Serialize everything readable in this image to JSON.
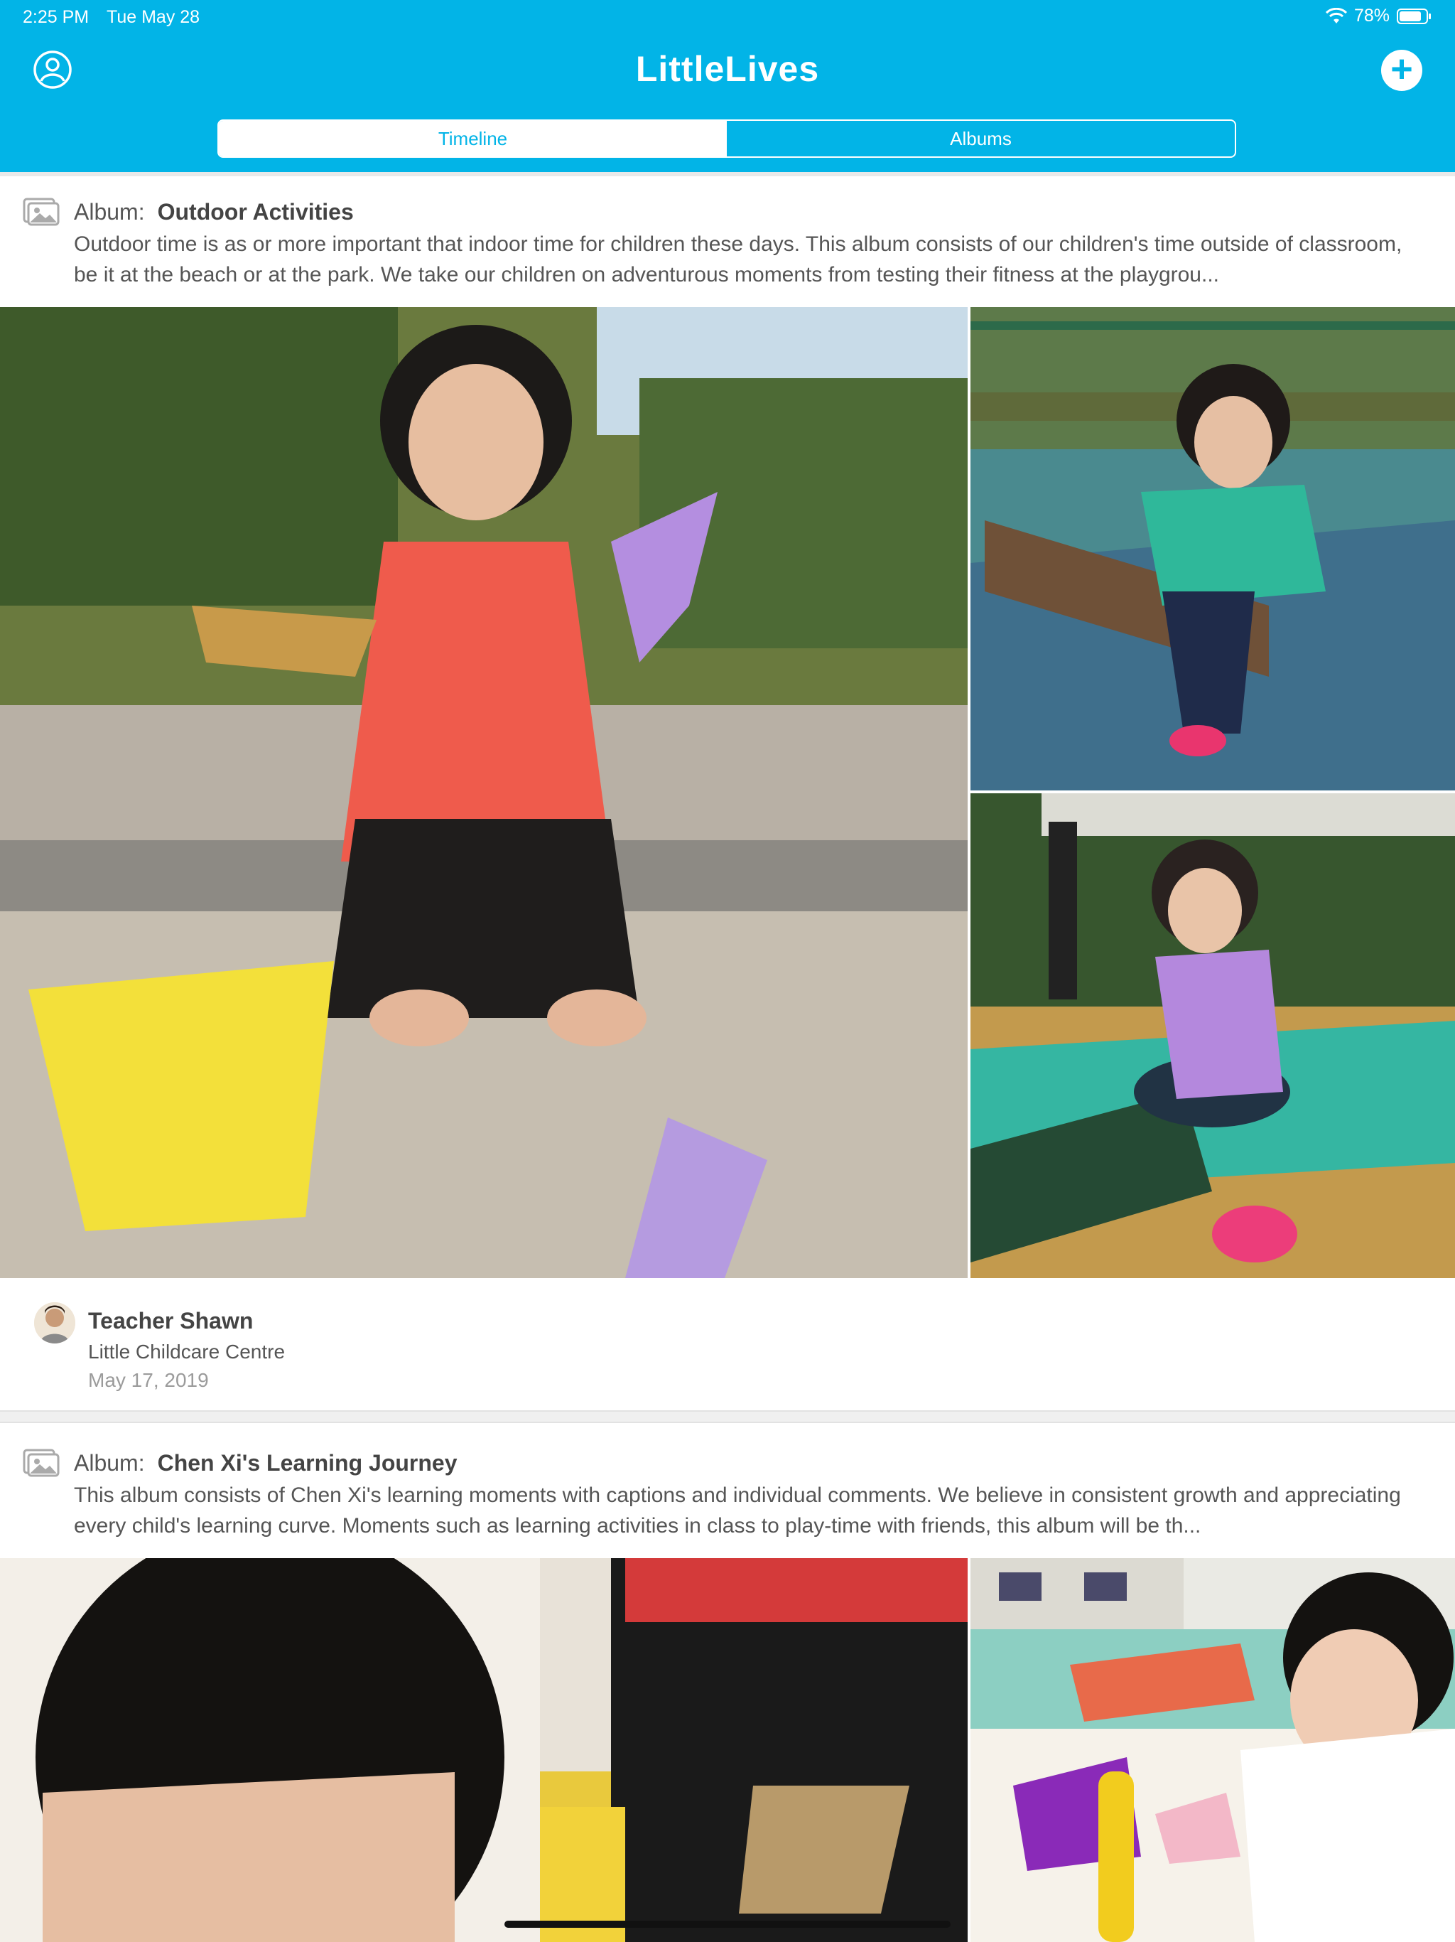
{
  "status_bar": {
    "time": "2:25 PM",
    "date": "Tue May 28",
    "battery": "78%"
  },
  "header": {
    "title": "LittleLives",
    "profile_icon": "profile-icon",
    "add_icon": "plus-icon",
    "add_label": "+"
  },
  "tabs": [
    {
      "label": "Timeline",
      "active": true
    },
    {
      "label": "Albums",
      "active": false
    }
  ],
  "albums": [
    {
      "prefix": "Album:",
      "name": "Outdoor Activities",
      "description": "Outdoor time is as or more important that indoor time for children these days. This album consists of our children's time outside of classroom, be it at the beach or at the park. We take our children on adventurous moments from testing their fitness at the playgrou...",
      "author": {
        "name": "Teacher Shawn",
        "school": "Little Childcare Centre",
        "date": "May 17, 2019"
      }
    },
    {
      "prefix": "Album:",
      "name": "Chen Xi's Learning Journey",
      "description": "This album consists of Chen Xi's learning moments with captions and individual comments. We believe in consistent growth and appreciating every child's learning curve. Moments such as learning activities in class to play-time with friends, this album will be th..."
    }
  ],
  "colors": {
    "brand": "#02b4e7",
    "text": "#555555",
    "muted": "#9b9b9b"
  }
}
